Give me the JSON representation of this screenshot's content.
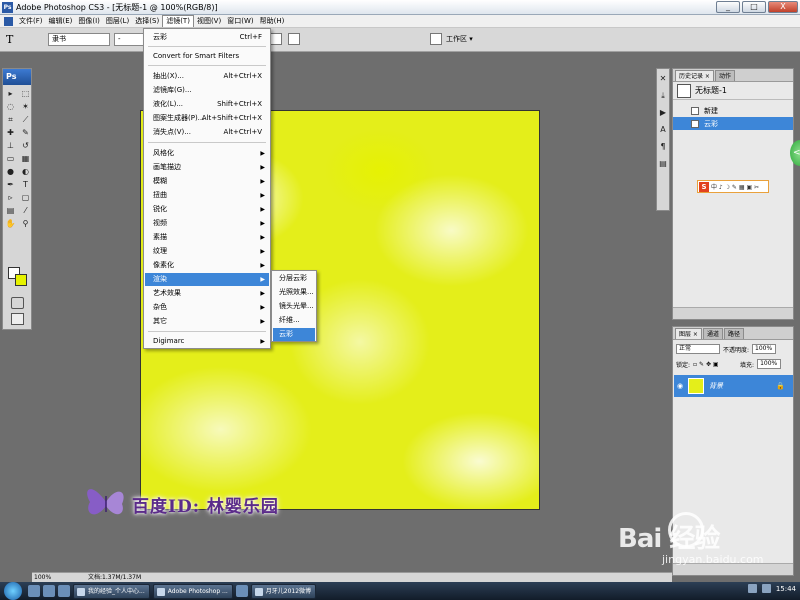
{
  "window": {
    "title": "Adobe Photoshop CS3 - [无标题-1 @ 100%(RGB/8)]",
    "minimize": "_",
    "maximize": "□",
    "close": "X"
  },
  "menubar": {
    "items": [
      "文件(F)",
      "编辑(E)",
      "图像(I)",
      "图层(L)",
      "选择(S)",
      "滤镜(T)",
      "视图(V)",
      "窗口(W)",
      "帮助(H)"
    ],
    "active_index": 5
  },
  "options": {
    "tool_glyph": "T",
    "font_family": "隶书",
    "font_style": "-",
    "workspace": "工作区 ▾"
  },
  "filter_menu": {
    "items": [
      {
        "label": "云彩",
        "shortcut": "Ctrl+F"
      },
      {
        "label": "Convert for Smart Filters",
        "shortcut": ""
      },
      {
        "label": "抽出(X)...",
        "shortcut": "Alt+Ctrl+X"
      },
      {
        "label": "滤镜库(G)...",
        "shortcut": ""
      },
      {
        "label": "液化(L)...",
        "shortcut": "Shift+Ctrl+X"
      },
      {
        "label": "图案生成器(P)...",
        "shortcut": "Alt+Shift+Ctrl+X"
      },
      {
        "label": "消失点(V)...",
        "shortcut": "Alt+Ctrl+V"
      },
      {
        "label": "风格化",
        "shortcut": ""
      },
      {
        "label": "画笔描边",
        "shortcut": ""
      },
      {
        "label": "模糊",
        "shortcut": ""
      },
      {
        "label": "扭曲",
        "shortcut": ""
      },
      {
        "label": "锐化",
        "shortcut": ""
      },
      {
        "label": "视频",
        "shortcut": ""
      },
      {
        "label": "素描",
        "shortcut": ""
      },
      {
        "label": "纹理",
        "shortcut": ""
      },
      {
        "label": "像素化",
        "shortcut": ""
      },
      {
        "label": "渲染",
        "shortcut": ""
      },
      {
        "label": "艺术效果",
        "shortcut": ""
      },
      {
        "label": "杂色",
        "shortcut": ""
      },
      {
        "label": "其它",
        "shortcut": ""
      },
      {
        "label": "Digimarc",
        "shortcut": ""
      }
    ],
    "arrow": "▶"
  },
  "render_submenu": {
    "items": [
      "分层云彩",
      "光照效果...",
      "镜头光晕...",
      "纤维...",
      "云彩"
    ],
    "highlighted_index": 4
  },
  "history_panel": {
    "tabs": [
      "历史记录 ×",
      "动作"
    ],
    "snapshot_name": "无标题-1",
    "steps": [
      "新建",
      "云彩"
    ]
  },
  "layers_panel": {
    "tabs": [
      "图层 ×",
      "通道",
      "路径"
    ],
    "blend_mode": "正常",
    "opacity_label": "不透明度:",
    "opacity_value": "100%",
    "lock_label": "锁定:",
    "fill_label": "填充:",
    "fill_value": "100%",
    "layer_name": "背景"
  },
  "ime_toolbar": {
    "logo": "S",
    "text": "中 ♪ ☽ ✎ ▦ ▣ ✂"
  },
  "status": {
    "zoom": "100%",
    "doc": "文档:1.37M/1.37M"
  },
  "watermark": {
    "id_text": "百度ID: 林婴乐园",
    "baidu_text": "Bai 经验",
    "baidu_sub": "jingyan.baidu.com"
  },
  "taskbar": {
    "items": [
      "我的经验_个人中心...",
      "Adobe Photoshop ...",
      "月牙儿2012微博"
    ],
    "clock": "15:44"
  },
  "colors": {
    "foreground": "#ffffff",
    "background": "#e6f200",
    "highlight": "#3d86d8"
  }
}
